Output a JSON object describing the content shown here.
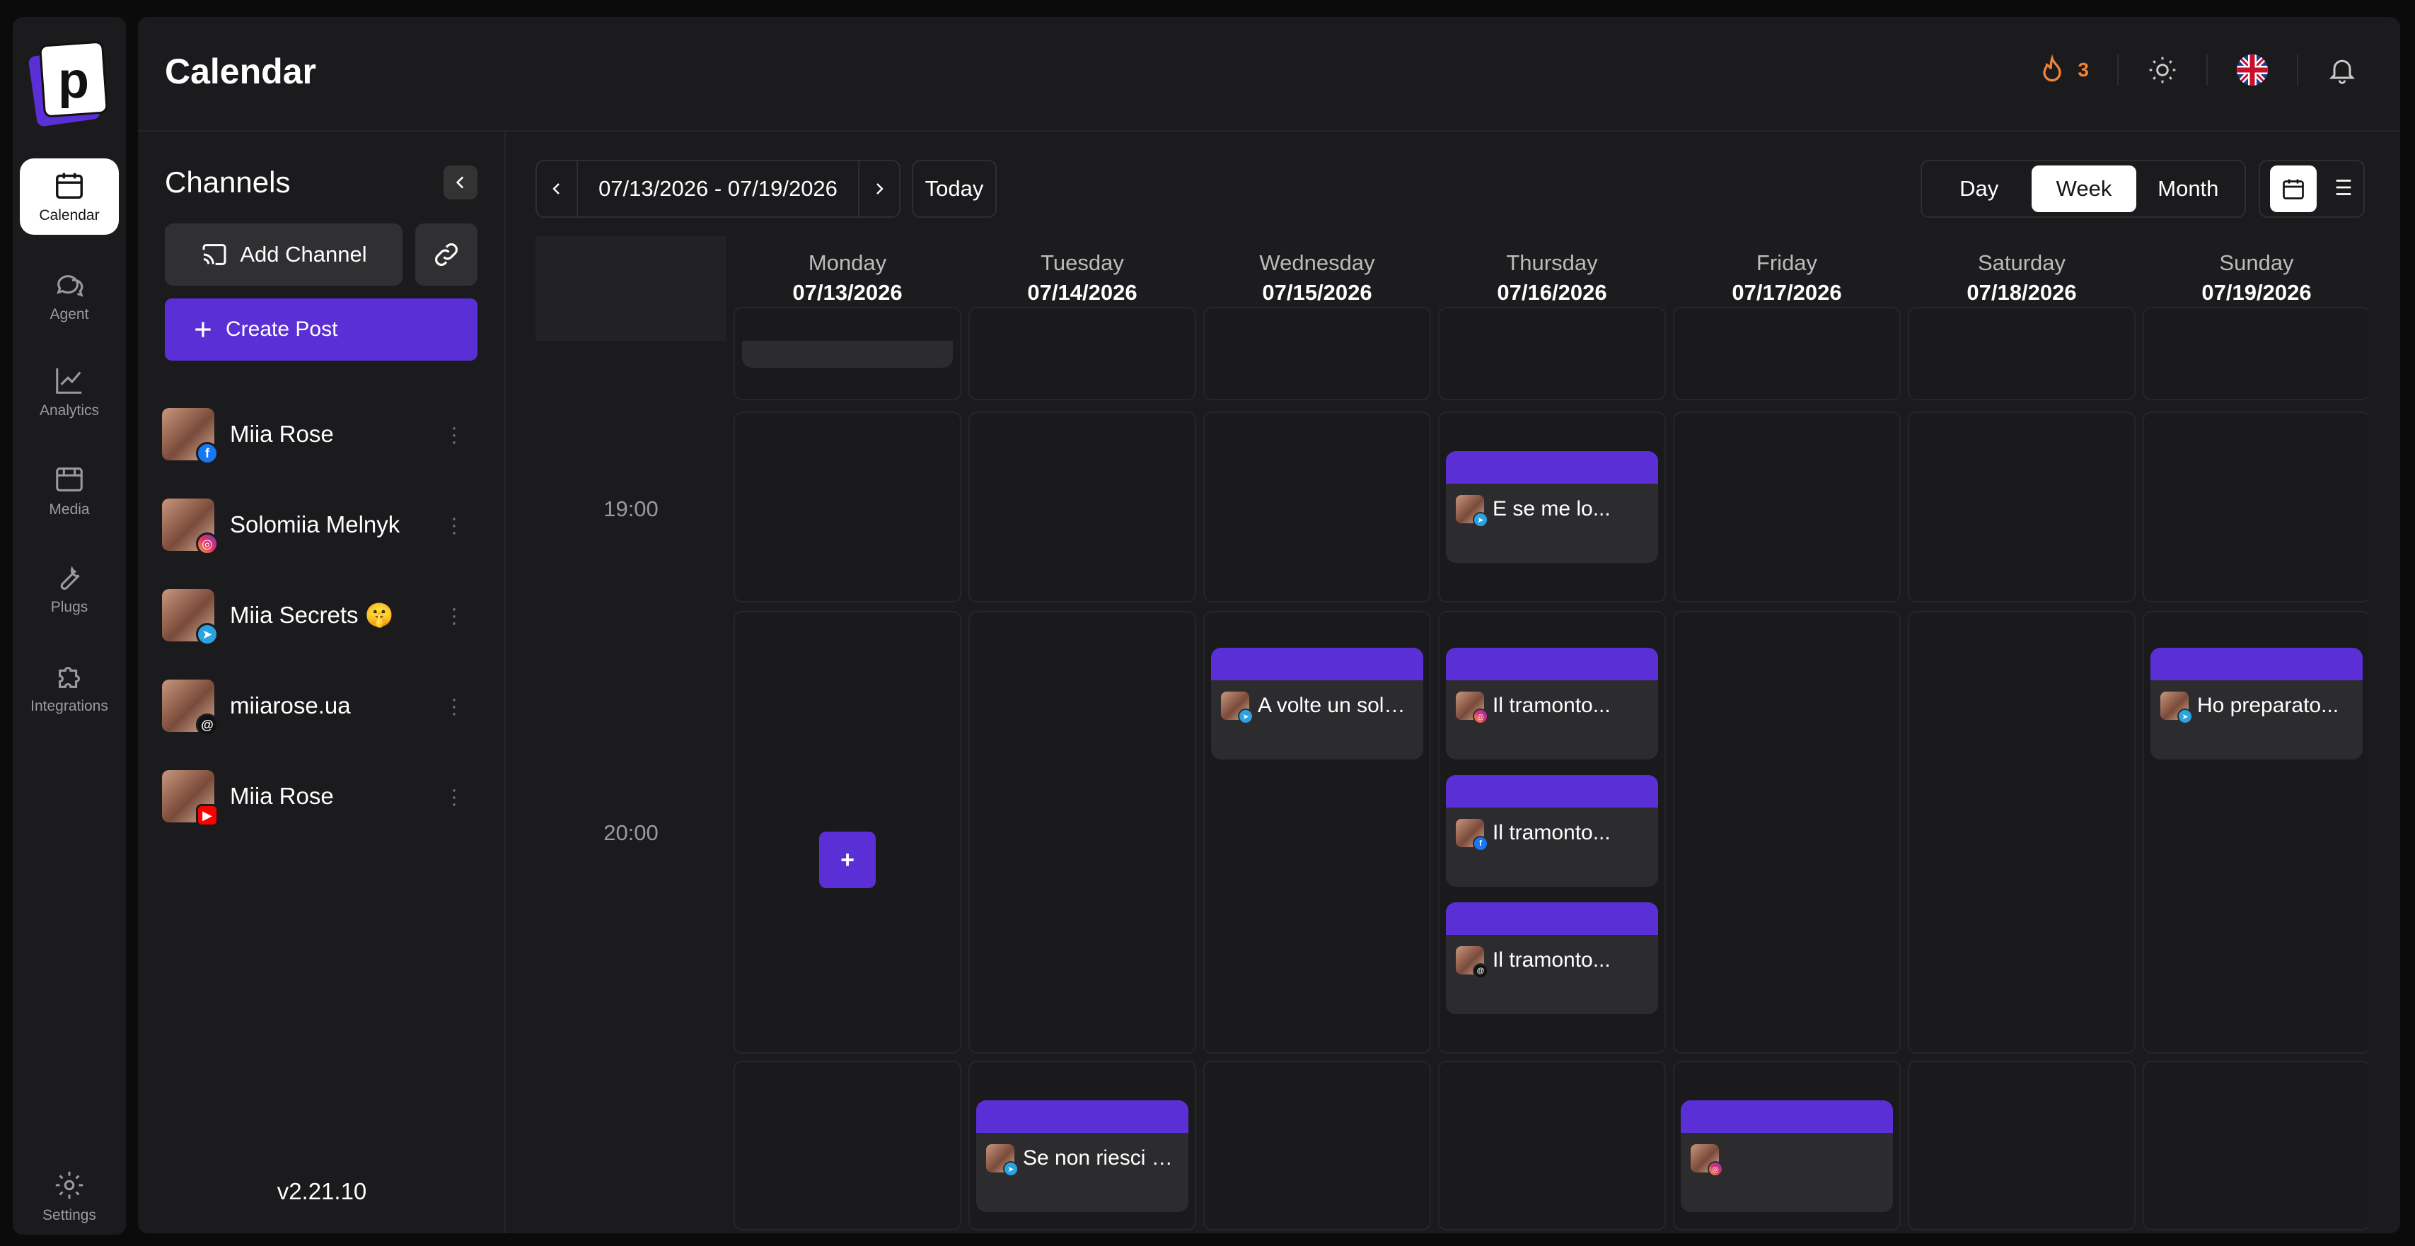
{
  "app": {
    "title": "Calendar",
    "version": "v2.21.10",
    "streak_count": "3",
    "accent": "#5b2fd6",
    "streak_color": "#f08438"
  },
  "nav": [
    {
      "label": "Calendar",
      "icon": "calendar-icon"
    },
    {
      "label": "Agent",
      "icon": "chat-icon"
    },
    {
      "label": "Analytics",
      "icon": "chart-icon"
    },
    {
      "label": "Media",
      "icon": "media-icon"
    },
    {
      "label": "Plugs",
      "icon": "wrench-icon"
    },
    {
      "label": "Integrations",
      "icon": "puzzle-icon"
    },
    {
      "label": "Settings",
      "icon": "gear-icon"
    }
  ],
  "sidebar": {
    "title": "Channels",
    "add_channel": "Add Channel",
    "create_post": "Create Post",
    "channels": [
      {
        "name": "Miia Rose",
        "network": "facebook"
      },
      {
        "name": "Solomiia Melnyk",
        "network": "instagram"
      },
      {
        "name": "Miia Secrets 🤫",
        "network": "telegram"
      },
      {
        "name": "miiarose.ua",
        "network": "threads"
      },
      {
        "name": "Miia Rose",
        "network": "youtube"
      }
    ]
  },
  "toolbar": {
    "range": "07/13/2026 - 07/19/2026",
    "today": "Today",
    "views": [
      "Day",
      "Week",
      "Month"
    ],
    "active_view": "Week"
  },
  "days": [
    {
      "day": "Monday",
      "date": "07/13/2026"
    },
    {
      "day": "Tuesday",
      "date": "07/14/2026"
    },
    {
      "day": "Wednesday",
      "date": "07/15/2026"
    },
    {
      "day": "Thursday",
      "date": "07/16/2026"
    },
    {
      "day": "Friday",
      "date": "07/17/2026"
    },
    {
      "day": "Saturday",
      "date": "07/18/2026"
    },
    {
      "day": "Sunday",
      "date": "07/19/2026"
    }
  ],
  "hours": [
    "19:00",
    "20:00"
  ],
  "posts": [
    {
      "day": "Thursday",
      "hour": "19:00",
      "text": "E se me lo...",
      "network": "telegram"
    },
    {
      "day": "Wednesday",
      "hour": "20:00",
      "text": "A volte un solo...",
      "network": "telegram"
    },
    {
      "day": "Thursday",
      "hour": "20:00",
      "text": "Il tramonto...",
      "network": "instagram"
    },
    {
      "day": "Thursday",
      "hour": "20:00",
      "text": "Il tramonto...",
      "network": "facebook"
    },
    {
      "day": "Thursday",
      "hour": "20:00",
      "text": "Il tramonto...",
      "network": "threads"
    },
    {
      "day": "Sunday",
      "hour": "20:00",
      "text": "Ho preparato...",
      "network": "telegram"
    },
    {
      "day": "Tuesday",
      "hour": "21:00",
      "text": "Se non riesci a...",
      "network": "telegram"
    },
    {
      "day": "Friday",
      "hour": "21:00",
      "text": "",
      "network": "instagram"
    }
  ],
  "add_button": "+"
}
